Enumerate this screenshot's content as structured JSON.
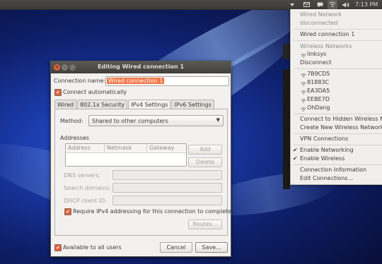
{
  "panel": {
    "time": "7:13 PM",
    "icons": [
      "sort-icon",
      "mail-icon",
      "chat-icon",
      "network-icon",
      "volume-icon"
    ]
  },
  "menu": {
    "wired_header": "Wired Network",
    "wired_status": "disconnected",
    "wired_connection": "Wired connection 1",
    "wireless_header": "Wireless Networks",
    "current_wireless": "linksys",
    "disconnect": "Disconnect",
    "networks": [
      "7B9CD5",
      "81883C",
      "EA3DA5",
      "EEBE7D",
      "OhDang"
    ],
    "hidden": "Connect to Hidden Wireless Ne",
    "create_new": "Create New Wireless Network...",
    "vpn": "VPN Connections",
    "enable_networking": "Enable Networking",
    "enable_wireless": "Enable Wireless",
    "connection_info": "Connection Information",
    "edit_connections": "Edit Connections..."
  },
  "dialog": {
    "title": "Editing Wired connection 1",
    "connection_name_label": "Connection name:",
    "connection_name_value": "Wired connection 1",
    "connect_auto": "Connect automatically",
    "tabs": [
      "Wired",
      "802.1x Security",
      "IPv4 Settings",
      "IPv6 Settings"
    ],
    "active_tab": "IPv4 Settings",
    "method_label": "Method:",
    "method_value": "Shared to other computers",
    "addresses_label": "Addresses",
    "columns": [
      "Address",
      "Netmask",
      "Gateway"
    ],
    "add": "Add",
    "delete": "Delete",
    "dns_label": "DNS servers:",
    "search_label": "Search domains:",
    "dhcp_label": "DHCP client ID:",
    "require_ipv4": "Require IPv4 addressing for this connection to complete",
    "routes": "Routes...",
    "available_all": "Available to all users",
    "cancel": "Cancel",
    "save": "Save..."
  }
}
